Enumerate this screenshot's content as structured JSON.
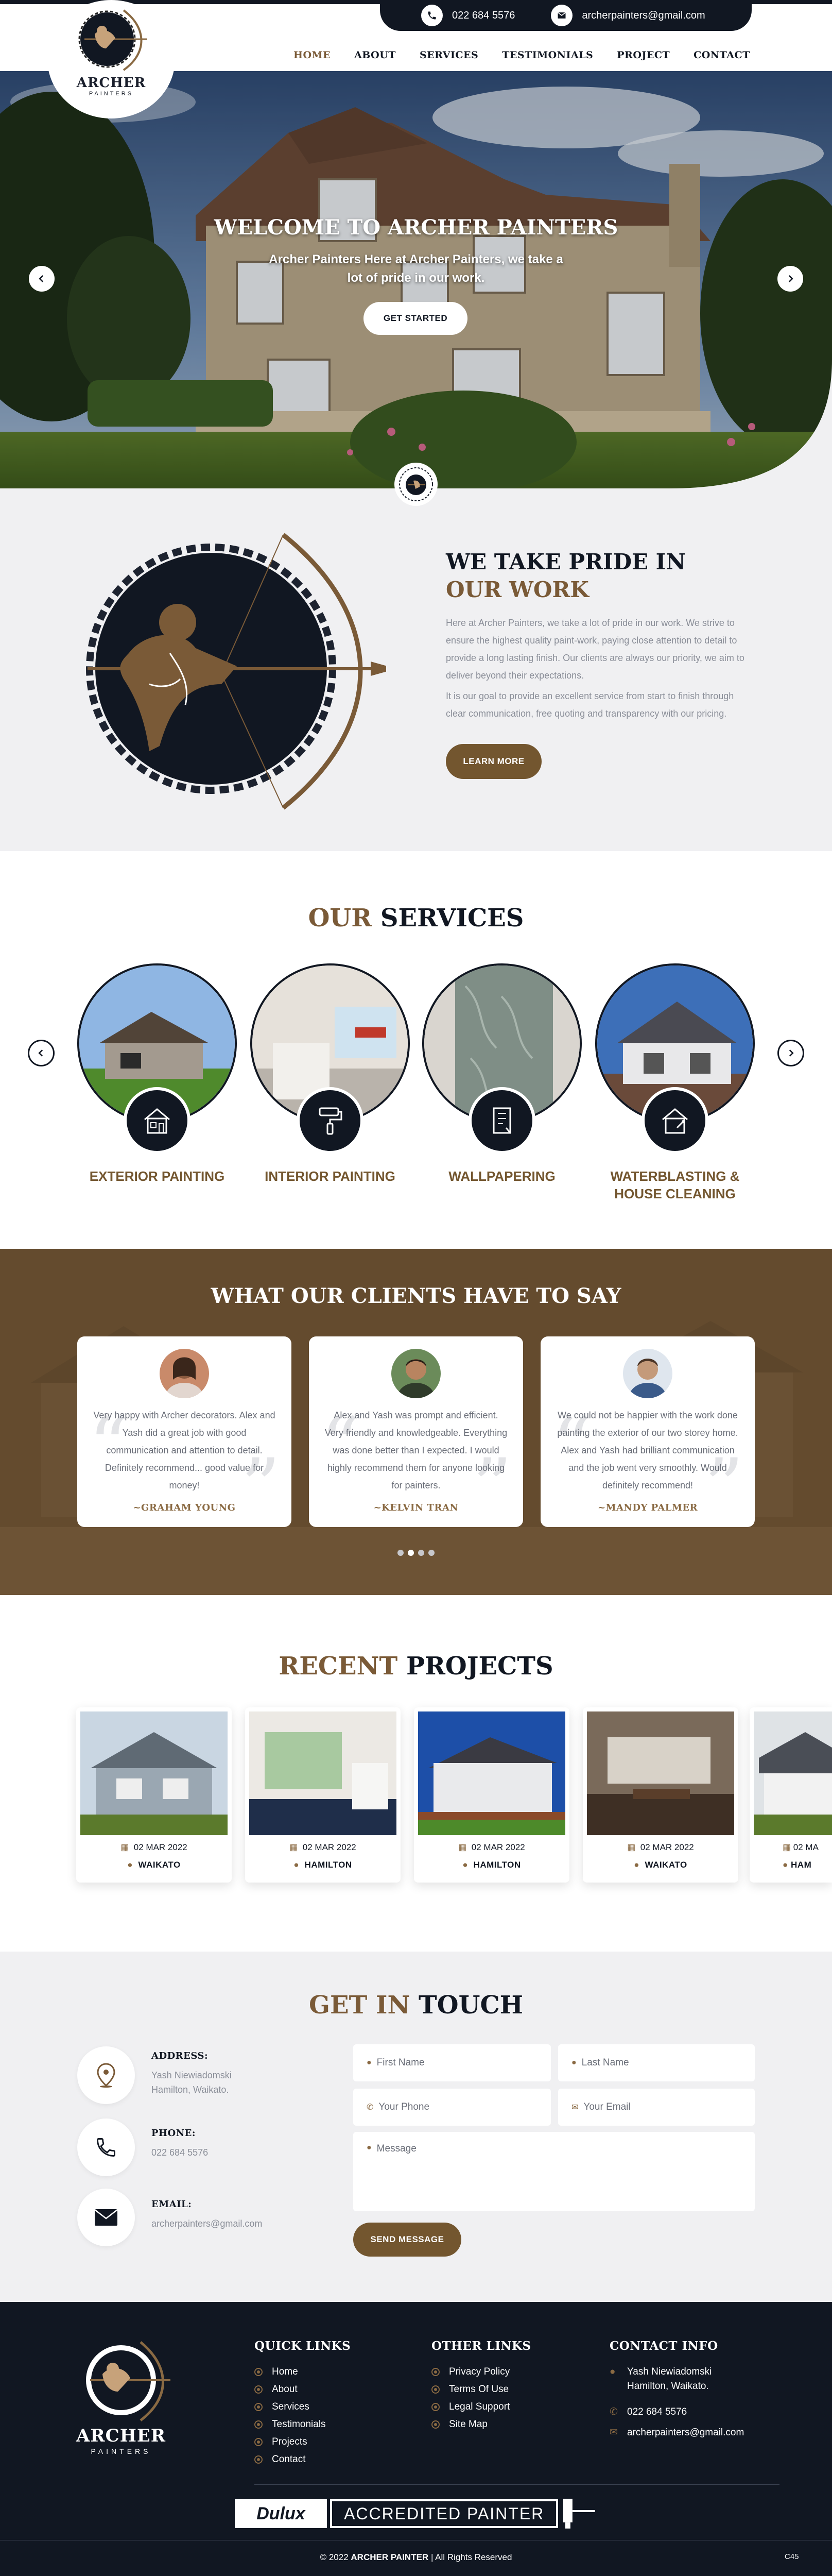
{
  "colors": {
    "navy": "#111722",
    "brown": "#73562f",
    "accent": "#7a5a37",
    "light_bg": "#f0f0f2"
  },
  "topbar": {
    "phone": "022 684 5576",
    "email": "archerpainters@gmail.com",
    "phone_icon": "phone-icon",
    "email_icon": "mail-icon"
  },
  "logo": {
    "name": "ARCHER",
    "sub": "PAINTERS"
  },
  "nav": {
    "items": [
      "HOME",
      "ABOUT",
      "SERVICES",
      "TESTIMONIALS",
      "PROJECT",
      "CONTACT"
    ],
    "active": "HOME"
  },
  "hero": {
    "title": "WELCOME TO ARCHER PAINTERS",
    "subtitle": "Archer Painters Here at Archer Painters, we take a lot of pride in our work.",
    "button": "GET STARTED"
  },
  "about": {
    "heading_line1": "WE TAKE PRIDE IN",
    "heading_line2": "OUR WORK",
    "para1": "Here at Archer Painters, we take a lot of pride in our work. We strive to ensure the highest quality paint-work, paying close attention to detail to provide a long lasting finish. Our clients are always our priority, we aim to deliver beyond their expectations.",
    "para2": "It is our goal to provide an excellent service from start to finish through clear communication, free quoting and transparency with our pricing.",
    "button": "LEARN MORE"
  },
  "services": {
    "title_accent": "OUR",
    "title_rest": "SERVICES",
    "items": [
      {
        "label": "EXTERIOR PAINTING",
        "icon": "house-icon"
      },
      {
        "label": "INTERIOR PAINTING",
        "icon": "paint-roller-icon"
      },
      {
        "label": "WALLPAPERING",
        "icon": "wallpaper-icon"
      },
      {
        "label": "WATERBLASTING & HOUSE CLEANING",
        "icon": "house-cleaning-icon"
      }
    ]
  },
  "testimonials": {
    "title": "WHAT OUR CLIENTS HAVE TO SAY",
    "items": [
      {
        "text": "Very happy with Archer decorators. Alex and Yash did a great job with good communication and attention to detail. Definitely recommend... good value for money!",
        "name": "~GRAHAM YOUNG"
      },
      {
        "text": "Alex and Yash was prompt and efficient. Very friendly and knowledgeable. Everything was done better than I expected. I would highly recommend them for anyone looking for painters.",
        "name": "~KELVIN TRAN"
      },
      {
        "text": "We could not be happier with the work done painting the exterior of our two storey home. Alex and Yash had brilliant communication and the job went very smoothly. Would definitely recommend!",
        "name": "~MANDY PALMER"
      }
    ]
  },
  "projects": {
    "title_accent": "RECENT",
    "title_rest": "PROJECTS",
    "items": [
      {
        "date": "02 MAR 2022",
        "location": "WAIKATO"
      },
      {
        "date": "02 MAR 2022",
        "location": "HAMILTON"
      },
      {
        "date": "02 MAR 2022",
        "location": "HAMILTON"
      },
      {
        "date": "02 MAR 2022",
        "location": "WAIKATO"
      },
      {
        "date": "02 MA",
        "location": "HAM"
      }
    ]
  },
  "contact": {
    "title_accent": "GET IN",
    "title_rest": "TOUCH",
    "address_label": "ADDRESS:",
    "address_line1": "Yash Niewiadomski",
    "address_line2": "Hamilton, Waikato.",
    "phone_label": "PHONE:",
    "phone": "022 684 5576",
    "email_label": "EMAIL:",
    "email": "archerpainters@gmail.com",
    "placeholders": {
      "first": "First Name",
      "last": "Last Name",
      "phone": "Your Phone",
      "email": "Your Email",
      "message": "Message"
    },
    "button": "SEND MESSAGE"
  },
  "footer": {
    "quick_title": "QUICK LINKS",
    "quick_links": [
      "Home",
      "About",
      "Services",
      "Testimonials",
      "Projects",
      "Contact"
    ],
    "other_title": "OTHER LINKS",
    "other_links": [
      "Privacy Policy",
      "Terms Of Use",
      "Legal Support",
      "Site Map"
    ],
    "info_title": "CONTACT INFO",
    "info_address1": "Yash Niewiadomski",
    "info_address2": "Hamilton, Waikato.",
    "info_phone": "022 684 5576",
    "info_email": "archerpainters@gmail.com",
    "dulux_brand": "Dulux",
    "dulux_text": "ACCREDITED PAINTER",
    "copyright_pre": "© 2022",
    "copyright_brand": "ARCHER PAINTER",
    "copyright_post": "| All Rights Reserved",
    "code": "C45"
  }
}
